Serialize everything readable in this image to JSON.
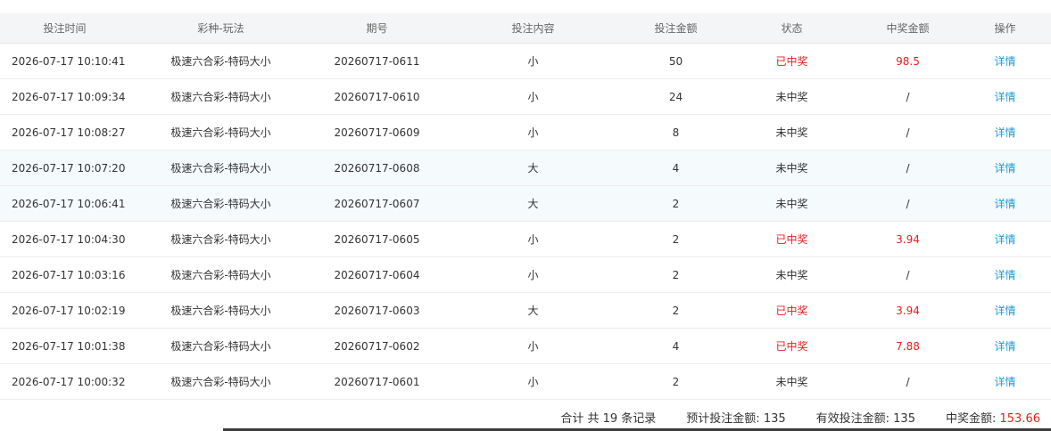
{
  "columns": [
    "投注时间",
    "彩种-玩法",
    "期号",
    "投注内容",
    "投注金额",
    "状态",
    "中奖金额",
    "操作"
  ],
  "rows": [
    {
      "time": "2026-07-17 10:10:41",
      "game": "极速六合彩-特码大小",
      "issue": "20260717-0611",
      "content": "小",
      "amount": "50",
      "status": "已中奖",
      "won": true,
      "prize": "98.5",
      "action": "详情"
    },
    {
      "time": "2026-07-17 10:09:34",
      "game": "极速六合彩-特码大小",
      "issue": "20260717-0610",
      "content": "小",
      "amount": "24",
      "status": "未中奖",
      "won": false,
      "prize": "/",
      "action": "详情"
    },
    {
      "time": "2026-07-17 10:08:27",
      "game": "极速六合彩-特码大小",
      "issue": "20260717-0609",
      "content": "小",
      "amount": "8",
      "status": "未中奖",
      "won": false,
      "prize": "/",
      "action": "详情"
    },
    {
      "time": "2026-07-17 10:07:20",
      "game": "极速六合彩-特码大小",
      "issue": "20260717-0608",
      "content": "大",
      "amount": "4",
      "status": "未中奖",
      "won": false,
      "prize": "/",
      "action": "详情"
    },
    {
      "time": "2026-07-17 10:06:41",
      "game": "极速六合彩-特码大小",
      "issue": "20260717-0607",
      "content": "大",
      "amount": "2",
      "status": "未中奖",
      "won": false,
      "prize": "/",
      "action": "详情"
    },
    {
      "time": "2026-07-17 10:04:30",
      "game": "极速六合彩-特码大小",
      "issue": "20260717-0605",
      "content": "小",
      "amount": "2",
      "status": "已中奖",
      "won": true,
      "prize": "3.94",
      "action": "详情"
    },
    {
      "time": "2026-07-17 10:03:16",
      "game": "极速六合彩-特码大小",
      "issue": "20260717-0604",
      "content": "小",
      "amount": "2",
      "status": "未中奖",
      "won": false,
      "prize": "/",
      "action": "详情"
    },
    {
      "time": "2026-07-17 10:02:19",
      "game": "极速六合彩-特码大小",
      "issue": "20260717-0603",
      "content": "大",
      "amount": "2",
      "status": "已中奖",
      "won": true,
      "prize": "3.94",
      "action": "详情"
    },
    {
      "time": "2026-07-17 10:01:38",
      "game": "极速六合彩-特码大小",
      "issue": "20260717-0602",
      "content": "小",
      "amount": "4",
      "status": "已中奖",
      "won": true,
      "prize": "7.88",
      "action": "详情"
    },
    {
      "time": "2026-07-17 10:00:32",
      "game": "极速六合彩-特码大小",
      "issue": "20260717-0601",
      "content": "小",
      "amount": "2",
      "status": "未中奖",
      "won": false,
      "prize": "/",
      "action": "详情"
    }
  ],
  "highlighted_rows": [
    3,
    4
  ],
  "footer": {
    "total_label": "合计 共 19 条记录",
    "expected_label": "预计投注金额: ",
    "expected_value": "135",
    "valid_label": "有效投注金额: ",
    "valid_value": "135",
    "prize_label": "中奖金额: ",
    "prize_value": "153.66"
  },
  "colors": {
    "won": "#e5201f",
    "link": "#1d9bd6",
    "header_bg": "#f4f5f7"
  }
}
